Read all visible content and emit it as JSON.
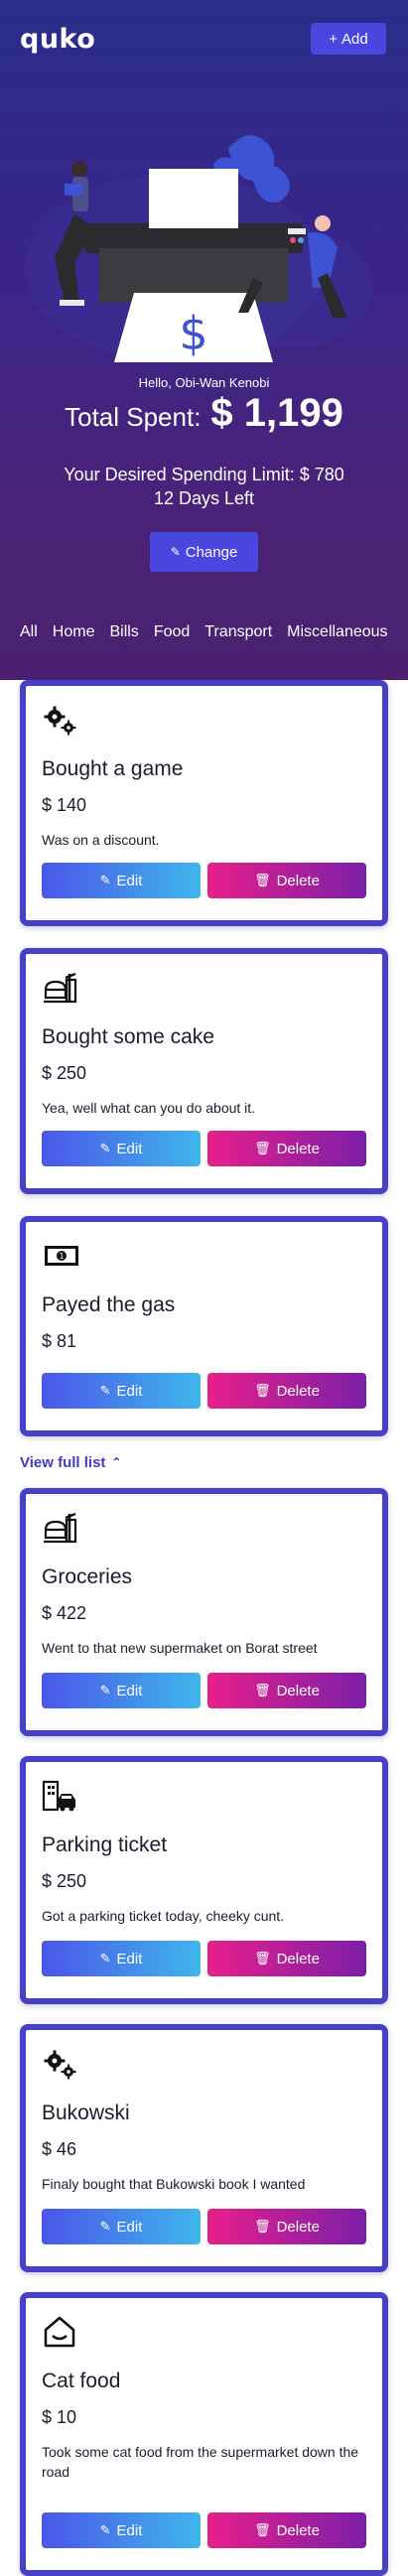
{
  "app": {
    "logo": "quko",
    "add_label": "Add",
    "add_icon": "plus-icon"
  },
  "summary": {
    "greeting": "Hello, Obi-Wan Kenobi",
    "total_label": "Total Spent:",
    "total_value": "$ 1,199",
    "limit_text": "Your Desired Spending Limit: $ 780",
    "days_left": "12 Days Left",
    "change_label": "Change",
    "change_icon": "pencil-icon"
  },
  "filters": [
    "All",
    "Home",
    "Bills",
    "Food",
    "Transport",
    "Miscellaneous"
  ],
  "colors": {
    "accent": "#4a46e0",
    "card_border": "#4641c8",
    "edit_gradient": [
      "#4a56e8",
      "#3fb6ec"
    ],
    "delete_gradient": [
      "#e81f8a",
      "#7b1fa8"
    ]
  },
  "actions": {
    "edit_label": "Edit",
    "delete_label": "Delete"
  },
  "view_full": "View full list",
  "expenses": [
    {
      "icon": "gears-icon",
      "title": "Bought a game",
      "amount": "$ 140",
      "description": "Was on a discount."
    },
    {
      "icon": "food-icon",
      "title": "Bought some cake",
      "amount": "$ 250",
      "description": "Yea, well what can you do about it."
    },
    {
      "icon": "money-icon",
      "title": "Payed the gas",
      "amount": "$ 81",
      "description": ""
    },
    {
      "icon": "food-icon",
      "title": "Groceries",
      "amount": "$ 422",
      "description": "Went to that new supermaket on Borat street"
    },
    {
      "icon": "transport-icon",
      "title": "Parking ticket",
      "amount": "$ 250",
      "description": "Got a parking ticket today, cheeky cunt."
    },
    {
      "icon": "gears-icon",
      "title": "Bukowski",
      "amount": "$ 46",
      "description": "Finaly bought that Bukowski book I wanted"
    },
    {
      "icon": "home-icon",
      "title": "Cat food",
      "amount": "$ 10",
      "description": "Took some cat food from the supermarket down the road"
    }
  ]
}
